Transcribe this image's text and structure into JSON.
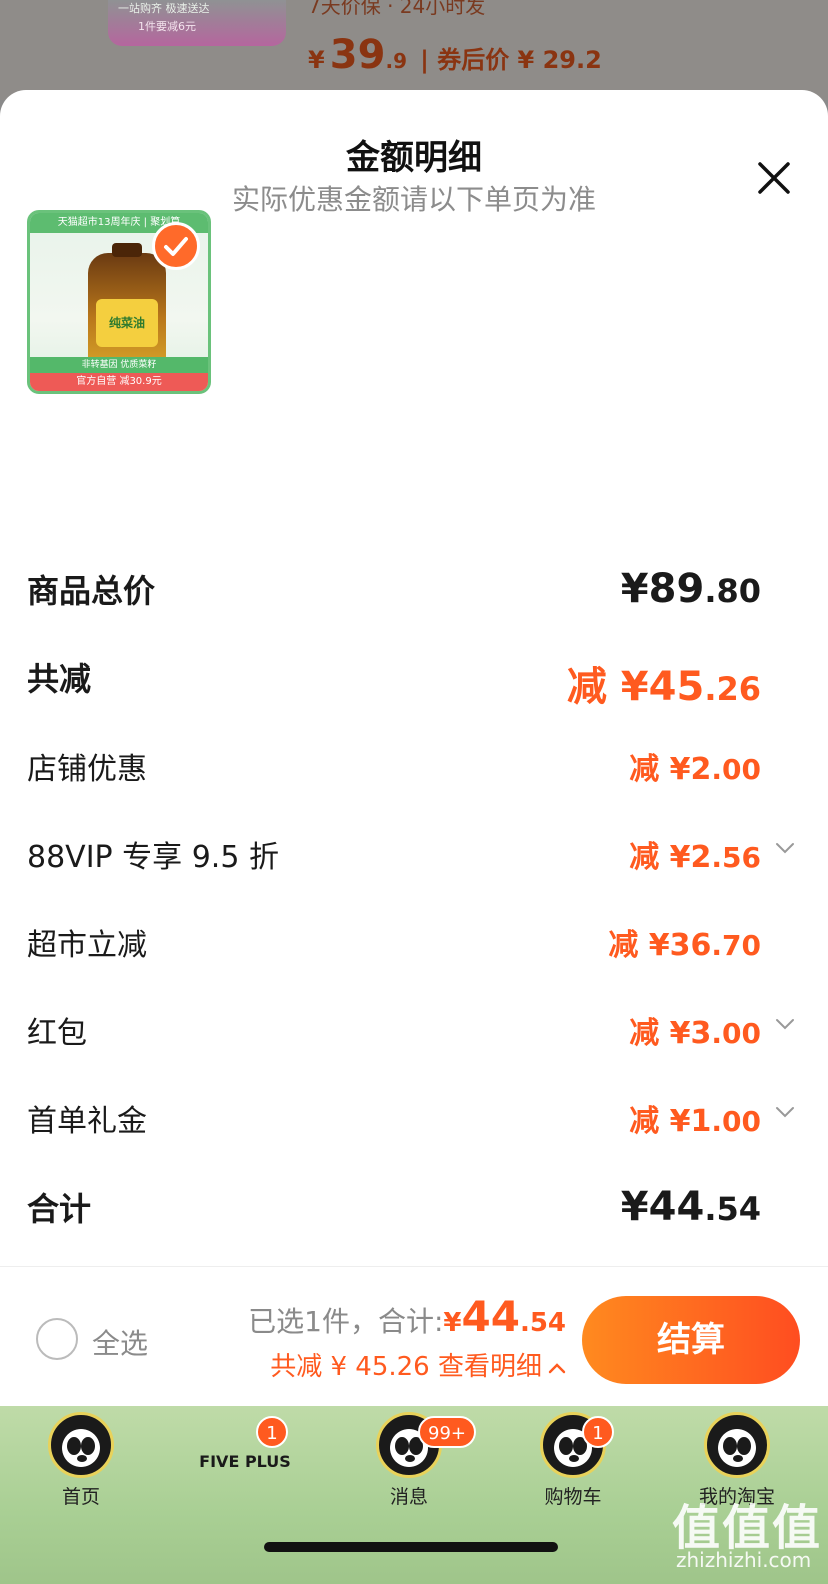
{
  "background_product": {
    "thumb_line1": "一站购齐 极速送达",
    "thumb_line2": "1件要减6元",
    "tag_text": "7天价保 · 24小时发",
    "price_symbol": "¥",
    "price_int": "39",
    "price_dec": ".9",
    "after_coupon": "| 券后价 ¥ 29.2"
  },
  "sheet": {
    "title": "金额明细",
    "subtitle": "实际优惠金额请以下单页为准"
  },
  "product": {
    "ribbon": "天猫超市13周年庆 | 聚划算",
    "label": "纯菜油",
    "strip1": "非转基因 优质菜籽",
    "strip2": "官方自营 减30.9元"
  },
  "rows": [
    {
      "label": "商品总价",
      "prefix": "¥",
      "int": "89",
      "dec": ".80"
    },
    {
      "label": "共减",
      "prefix": "减 ¥",
      "int": "45",
      "dec": ".26"
    },
    {
      "label": "店铺优惠",
      "prefix": "减 ¥",
      "int": "2",
      "dec": ".00"
    },
    {
      "label": "88VIP 专享 9.5 折",
      "prefix": "减 ¥",
      "int": "2",
      "dec": ".56"
    },
    {
      "label": "超市立减",
      "prefix": "减 ¥",
      "int": "36",
      "dec": ".70"
    },
    {
      "label": "红包",
      "prefix": "减 ¥",
      "int": "3",
      "dec": ".00"
    },
    {
      "label": "首单礼金",
      "prefix": "减 ¥",
      "int": "1",
      "dec": ".00"
    },
    {
      "label": "合计",
      "prefix": "¥",
      "int": "44",
      "dec": ".54"
    }
  ],
  "bottom_bar": {
    "select_all": "全选",
    "summary_label": "已选1件，合计:",
    "summary_symbol": "¥",
    "summary_int": "44",
    "summary_dec": ".54",
    "savings_text": "共减 ¥ 45.26  查看明细",
    "checkout": "结算"
  },
  "tabs": [
    {
      "label": "首页",
      "badge": ""
    },
    {
      "label": "FIVE PLUS",
      "badge": "1"
    },
    {
      "label": "消息",
      "badge": "99+"
    },
    {
      "label": "购物车",
      "badge": "1"
    },
    {
      "label": "我的淘宝",
      "badge": ""
    }
  ],
  "watermark": {
    "text": "值值值",
    "url": "zhizhizhi.com"
  },
  "colors": {
    "accent": "#ff5a1f",
    "checkout_start": "#ff8a1f",
    "checkout_end": "#ff4d20",
    "tabbar": "#b3d59c"
  },
  "icons": [
    "close-icon",
    "check-icon",
    "chevron-down-icon",
    "chevron-up-icon",
    "radio-icon",
    "panda-avatar-icon"
  ]
}
